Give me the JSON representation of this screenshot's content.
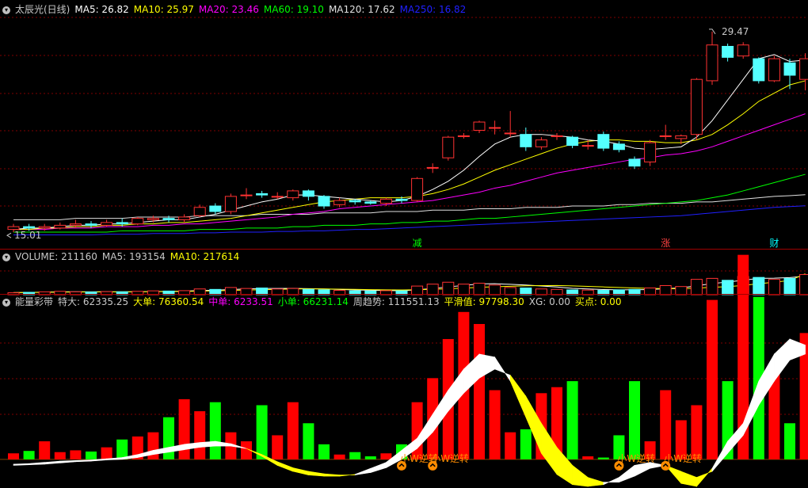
{
  "colors": {
    "up": "#ff3232",
    "down": "#54ffff",
    "ma5": "#ffffff",
    "ma10": "#ffff00",
    "ma20": "#ff00ff",
    "ma60": "#00ff00",
    "ma120": "#e0e0e0",
    "ma250": "#2020ff",
    "grid": "#800000",
    "energy_up": "#ff0000",
    "energy_down": "#00ff00",
    "trend_up": "#ffffff",
    "trend_down": "#ffff00",
    "signal": "#ff8c00"
  },
  "price_panel": {
    "legend": [
      {
        "text": "太辰光(日线)",
        "color": "#c8c8c8"
      },
      {
        "text": "MA5: 26.82",
        "color": "#ffffff"
      },
      {
        "text": "MA10: 25.97",
        "color": "#ffff00"
      },
      {
        "text": "MA20: 23.46",
        "color": "#ff00ff"
      },
      {
        "text": "MA60: 19.10",
        "color": "#00ff00"
      },
      {
        "text": "MA120: 17.62",
        "color": "#e0e0e0"
      },
      {
        "text": "MA250: 16.82",
        "color": "#2020ff"
      }
    ],
    "high_label": "29.47",
    "low_label": "15.01",
    "markers": [
      {
        "text": "减",
        "color": "#00ff00",
        "bar": 26
      },
      {
        "text": "涨",
        "color": "#ff4040",
        "bar": 42
      },
      {
        "text": "财",
        "color": "#00ffff",
        "bar": 49
      }
    ]
  },
  "volume_panel": {
    "legend": [
      {
        "text": "VOLUME: 211160",
        "color": "#c8c8c8"
      },
      {
        "text": "MA5: 193154",
        "color": "#c8c8c8"
      },
      {
        "text": "MA10: 217614",
        "color": "#ffff00"
      }
    ]
  },
  "energy_panel": {
    "legend": [
      {
        "text": "能量彩带",
        "color": "#c8c8c8"
      },
      {
        "text": "特大: 62335.25",
        "color": "#c8c8c8"
      },
      {
        "text": "大单: 76360.54",
        "color": "#ffff00"
      },
      {
        "text": "中单: 6233.51",
        "color": "#ff00ff"
      },
      {
        "text": "小单: 66231.14",
        "color": "#00ff00"
      },
      {
        "text": "周趋势: 111551.13",
        "color": "#c8c8c8"
      },
      {
        "text": "平滑值: 97798.30",
        "color": "#ffff00"
      },
      {
        "text": "XG: 0.00",
        "color": "#c8c8c8"
      },
      {
        "text": "买点: 0.00",
        "color": "#ffff00"
      }
    ],
    "signals": [
      {
        "text": "小W逆转",
        "bar": 25
      },
      {
        "text": "小W逆转",
        "bar": 27
      },
      {
        "text": "小W逆转",
        "bar": 39
      },
      {
        "text": "小W逆转",
        "bar": 42
      }
    ]
  },
  "chart_data": {
    "type": "candlestick",
    "ylim_price": [
      14.5,
      30.5
    ],
    "ylim_volume": [
      0,
      330000
    ],
    "ylim_energy": [
      -45000,
      250000
    ],
    "candles": [
      [
        15.1,
        15.3,
        15.5,
        14.9
      ],
      [
        15.3,
        15.2,
        15.5,
        15.0
      ],
      [
        15.2,
        15.3,
        15.5,
        15.0
      ],
      [
        15.2,
        15.4,
        15.6,
        15.1
      ],
      [
        15.4,
        15.5,
        15.8,
        15.2
      ],
      [
        15.5,
        15.4,
        15.7,
        15.2
      ],
      [
        15.4,
        15.6,
        15.8,
        15.3
      ],
      [
        15.6,
        15.5,
        15.9,
        15.3
      ],
      [
        15.5,
        15.9,
        16.0,
        15.4
      ],
      [
        15.8,
        15.9,
        16.1,
        15.6
      ],
      [
        15.9,
        15.8,
        16.1,
        15.6
      ],
      [
        15.8,
        16.0,
        16.2,
        15.6
      ],
      [
        16.1,
        16.7,
        16.9,
        16.0
      ],
      [
        16.8,
        16.4,
        17.0,
        16.2
      ],
      [
        16.4,
        17.5,
        17.7,
        16.2
      ],
      [
        17.6,
        17.6,
        18.1,
        17.3
      ],
      [
        17.7,
        17.6,
        17.9,
        17.4
      ],
      [
        17.5,
        17.5,
        17.8,
        17.3
      ],
      [
        17.4,
        17.9,
        18.0,
        17.2
      ],
      [
        17.9,
        17.5,
        18.0,
        17.2
      ],
      [
        17.5,
        16.8,
        17.6,
        16.6
      ],
      [
        16.9,
        17.2,
        17.4,
        16.7
      ],
      [
        17.2,
        17.1,
        17.3,
        16.9
      ],
      [
        17.1,
        17.0,
        17.2,
        16.9
      ],
      [
        17.0,
        17.3,
        17.4,
        16.8
      ],
      [
        17.3,
        17.2,
        17.5,
        17.0
      ],
      [
        17.2,
        18.8,
        18.9,
        17.1
      ],
      [
        19.6,
        19.6,
        19.9,
        19.2
      ],
      [
        20.3,
        21.8,
        21.9,
        20.1
      ],
      [
        21.9,
        21.9,
        22.1,
        21.7
      ],
      [
        22.3,
        22.9,
        23.0,
        22.1
      ],
      [
        22.5,
        22.5,
        23.0,
        22.0
      ],
      [
        22.1,
        22.1,
        23.7,
        21.8
      ],
      [
        22.0,
        21.1,
        22.5,
        20.8
      ],
      [
        21.1,
        21.6,
        21.8,
        20.9
      ],
      [
        21.9,
        21.9,
        22.1,
        21.6
      ],
      [
        21.8,
        21.2,
        21.9,
        21.0
      ],
      [
        21.2,
        21.2,
        21.6,
        20.9
      ],
      [
        22.0,
        21.0,
        22.2,
        20.8
      ],
      [
        21.3,
        20.9,
        21.5,
        20.7
      ],
      [
        20.2,
        19.7,
        20.4,
        19.5
      ],
      [
        20.0,
        21.4,
        21.6,
        19.7
      ],
      [
        21.9,
        21.9,
        22.7,
        21.6
      ],
      [
        21.7,
        21.9,
        22.0,
        21.3
      ],
      [
        22.0,
        26.0,
        26.1,
        21.6
      ],
      [
        25.9,
        28.5,
        29.47,
        25.6
      ],
      [
        28.4,
        27.6,
        28.6,
        27.3
      ],
      [
        27.7,
        28.5,
        28.7,
        27.5
      ],
      [
        27.5,
        25.9,
        27.6,
        25.7
      ],
      [
        25.9,
        27.5,
        27.7,
        25.8
      ],
      [
        27.2,
        26.3,
        27.5,
        25.3
      ],
      [
        26.0,
        27.5,
        27.9,
        25.2
      ]
    ],
    "ma5": [
      15.1,
      15.2,
      15.2,
      15.3,
      15.4,
      15.4,
      15.5,
      15.5,
      15.6,
      15.7,
      15.8,
      15.8,
      16.0,
      16.2,
      16.5,
      16.8,
      17.1,
      17.3,
      17.6,
      17.6,
      17.5,
      17.4,
      17.3,
      17.2,
      17.1,
      17.2,
      17.5,
      18.0,
      18.6,
      19.4,
      20.4,
      21.3,
      21.8,
      22.0,
      22.0,
      21.9,
      21.8,
      21.6,
      21.5,
      21.3,
      21.0,
      20.9,
      21.0,
      21.1,
      21.8,
      23.0,
      24.5,
      26.0,
      27.5,
      27.8,
      27.3,
      27.4
    ],
    "ma10": [
      15.1,
      15.1,
      15.2,
      15.2,
      15.3,
      15.3,
      15.4,
      15.4,
      15.5,
      15.5,
      15.6,
      15.6,
      15.7,
      15.8,
      15.9,
      16.1,
      16.3,
      16.5,
      16.7,
      16.9,
      17.1,
      17.2,
      17.3,
      17.4,
      17.4,
      17.4,
      17.5,
      17.7,
      18.0,
      18.4,
      18.9,
      19.4,
      19.8,
      20.2,
      20.6,
      21.0,
      21.3,
      21.5,
      21.6,
      21.6,
      21.5,
      21.5,
      21.4,
      21.4,
      21.6,
      22.0,
      22.7,
      23.5,
      24.4,
      25.0,
      25.6,
      25.9
    ],
    "ma20": [
      15.1,
      15.1,
      15.1,
      15.2,
      15.2,
      15.2,
      15.3,
      15.3,
      15.3,
      15.4,
      15.4,
      15.5,
      15.5,
      15.6,
      15.7,
      15.8,
      15.9,
      16.0,
      16.2,
      16.3,
      16.4,
      16.6,
      16.7,
      16.8,
      16.9,
      17.0,
      17.1,
      17.2,
      17.4,
      17.6,
      17.8,
      18.1,
      18.3,
      18.6,
      18.9,
      19.2,
      19.4,
      19.6,
      19.8,
      20.0,
      20.2,
      20.3,
      20.5,
      20.6,
      20.8,
      21.1,
      21.5,
      21.9,
      22.3,
      22.7,
      23.1,
      23.5
    ],
    "ma60": [
      14.9,
      14.9,
      14.9,
      14.9,
      14.9,
      14.9,
      14.9,
      15.0,
      15.0,
      15.0,
      15.0,
      15.0,
      15.1,
      15.1,
      15.1,
      15.2,
      15.2,
      15.2,
      15.3,
      15.3,
      15.4,
      15.4,
      15.4,
      15.5,
      15.5,
      15.6,
      15.6,
      15.7,
      15.7,
      15.8,
      15.9,
      15.9,
      16.0,
      16.1,
      16.2,
      16.3,
      16.4,
      16.5,
      16.6,
      16.7,
      16.8,
      16.9,
      17.0,
      17.1,
      17.2,
      17.4,
      17.6,
      17.9,
      18.2,
      18.5,
      18.8,
      19.1
    ],
    "ma120": [
      15.8,
      15.8,
      15.8,
      15.8,
      15.9,
      15.9,
      15.9,
      15.9,
      16.0,
      16.0,
      16.0,
      16.0,
      16.1,
      16.1,
      16.1,
      16.1,
      16.2,
      16.2,
      16.2,
      16.2,
      16.3,
      16.3,
      16.3,
      16.3,
      16.4,
      16.4,
      16.4,
      16.5,
      16.5,
      16.5,
      16.6,
      16.6,
      16.6,
      16.7,
      16.7,
      16.7,
      16.8,
      16.8,
      16.8,
      16.9,
      16.9,
      17.0,
      17.0,
      17.0,
      17.1,
      17.1,
      17.2,
      17.3,
      17.4,
      17.5,
      17.55,
      17.62
    ],
    "ma250": [
      14.7,
      14.7,
      14.7,
      14.7,
      14.7,
      14.7,
      14.75,
      14.75,
      14.75,
      14.8,
      14.8,
      14.8,
      14.85,
      14.85,
      14.9,
      14.9,
      14.9,
      14.95,
      14.95,
      15.0,
      15.0,
      15.05,
      15.1,
      15.1,
      15.15,
      15.2,
      15.25,
      15.3,
      15.35,
      15.4,
      15.45,
      15.5,
      15.55,
      15.6,
      15.65,
      15.7,
      15.75,
      15.8,
      15.85,
      15.9,
      15.95,
      16.0,
      16.05,
      16.1,
      16.2,
      16.3,
      16.4,
      16.5,
      16.6,
      16.7,
      16.76,
      16.82
    ],
    "volume": [
      20000,
      25000,
      30000,
      35000,
      30000,
      28000,
      32000,
      30000,
      35000,
      40000,
      38000,
      42000,
      60000,
      55000,
      75000,
      65000,
      70000,
      60000,
      65000,
      55000,
      50000,
      45000,
      40000,
      38000,
      42000,
      40000,
      90000,
      110000,
      130000,
      110000,
      120000,
      100000,
      75000,
      70000,
      60000,
      55000,
      50000,
      48000,
      45000,
      50000,
      55000,
      70000,
      95000,
      85000,
      160000,
      170000,
      150000,
      190000,
      180000,
      160000,
      170000,
      210000
    ],
    "vol_ma5": [
      22000,
      24000,
      27000,
      30000,
      31000,
      30000,
      31000,
      30000,
      31000,
      33000,
      35000,
      37000,
      43000,
      47000,
      54000,
      60000,
      65000,
      65000,
      66000,
      63000,
      60000,
      55000,
      50000,
      46000,
      43000,
      41000,
      52000,
      64000,
      82000,
      96000,
      112000,
      114000,
      108000,
      101000,
      91000,
      80000,
      66000,
      60000,
      54000,
      51000,
      52000,
      54000,
      63000,
      71000,
      93000,
      116000,
      132000,
      151000,
      170000,
      172000,
      178000,
      193154
    ],
    "vol_ma10": [
      22000,
      23000,
      25000,
      27000,
      28000,
      29000,
      29000,
      30000,
      31000,
      32000,
      33000,
      34000,
      37000,
      40000,
      44000,
      48000,
      52000,
      56000,
      60000,
      61000,
      60000,
      58000,
      56000,
      53000,
      51000,
      49000,
      52000,
      56000,
      62000,
      68000,
      77000,
      83000,
      88000,
      93000,
      95000,
      96000,
      92000,
      87000,
      81000,
      75000,
      70000,
      66000,
      63000,
      62000,
      69000,
      77000,
      84000,
      97000,
      114000,
      130000,
      148000,
      217614
    ],
    "energy": [
      10000,
      14000,
      30000,
      12000,
      15000,
      13000,
      20000,
      33000,
      38000,
      45000,
      70000,
      100000,
      80000,
      95000,
      45000,
      30000,
      90000,
      40000,
      95000,
      60000,
      25000,
      8000,
      12000,
      5000,
      10000,
      25000,
      95000,
      135000,
      200000,
      245000,
      225000,
      115000,
      45000,
      50000,
      110000,
      120000,
      130000,
      5000,
      3000,
      40000,
      130000,
      30000,
      115000,
      65000,
      90000,
      265000,
      130000,
      340000,
      270000,
      155000,
      60000,
      210000
    ],
    "trend": [
      -8000,
      -7000,
      -5000,
      -3000,
      -2000,
      -1000,
      1000,
      3000,
      8000,
      15000,
      20000,
      25000,
      28000,
      30000,
      26000,
      18000,
      5000,
      -10000,
      -20000,
      -26000,
      -28000,
      -28000,
      -25000,
      -15000,
      -5000,
      15000,
      35000,
      75000,
      115000,
      150000,
      175000,
      170000,
      130000,
      70000,
      10000,
      -25000,
      -42000,
      -45000,
      -42000,
      -30000,
      -10000,
      -5000,
      -10000,
      -40000,
      -45000,
      -15000,
      30000,
      60000,
      130000,
      175000,
      200000,
      190000
    ],
    "trend_smooth": [
      -10000,
      -9000,
      -8000,
      -6000,
      -4000,
      -3000,
      -1000,
      0,
      3000,
      8000,
      12000,
      16000,
      20000,
      22000,
      22000,
      18000,
      8000,
      -4000,
      -14000,
      -20000,
      -24000,
      -26000,
      -26000,
      -22000,
      -14000,
      0,
      18000,
      45000,
      80000,
      110000,
      135000,
      150000,
      140000,
      105000,
      60000,
      20000,
      -10000,
      -30000,
      -38000,
      -38000,
      -28000,
      -15000,
      -10000,
      -20000,
      -30000,
      -20000,
      10000,
      40000,
      90000,
      130000,
      165000,
      175000
    ]
  }
}
